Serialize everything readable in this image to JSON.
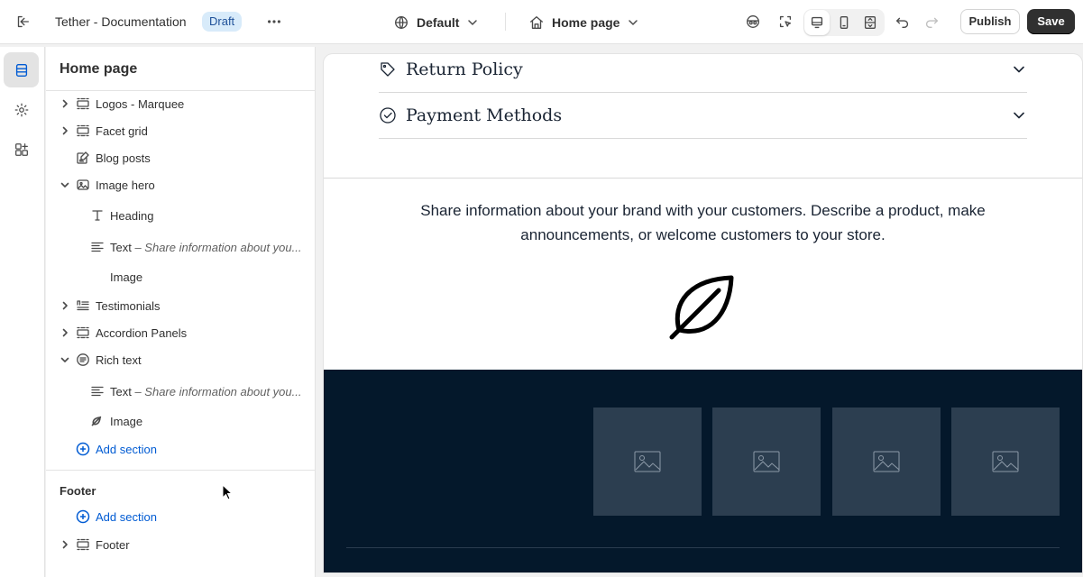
{
  "header": {
    "app_title": "Tether - Documentation",
    "status_badge": "Draft",
    "theme_select": "Default",
    "page_select": "Home page",
    "publish_label": "Publish",
    "save_label": "Save"
  },
  "sidebar": {
    "title": "Home page",
    "items": [
      {
        "label": "Logos - Marquee",
        "icon": "section-icon",
        "expandable": true,
        "expanded": false
      },
      {
        "label": "Facet grid",
        "icon": "section-icon",
        "expandable": true,
        "expanded": false
      },
      {
        "label": "Blog posts",
        "icon": "blog-icon",
        "expandable": false
      },
      {
        "label": "Image hero",
        "icon": "image-section-icon",
        "expandable": true,
        "expanded": true
      },
      {
        "label": "Heading",
        "icon": "text-type-icon",
        "level": 2
      },
      {
        "label": "Text",
        "suffix": " – Share information about you...",
        "icon": "text-lines-icon",
        "level": 2
      },
      {
        "label": "Image",
        "icon": "none",
        "level": 2
      },
      {
        "label": "Testimonials",
        "icon": "testimonials-icon",
        "expandable": true,
        "expanded": false
      },
      {
        "label": "Accordion Panels",
        "icon": "section-icon",
        "expandable": true,
        "expanded": false
      },
      {
        "label": "Rich text",
        "icon": "rich-text-icon",
        "expandable": true,
        "expanded": true
      },
      {
        "label": "Text",
        "suffix": " – Share information about you...",
        "icon": "text-lines-icon",
        "level": 2
      },
      {
        "label": "Image",
        "icon": "leaf-icon",
        "level": 2
      }
    ],
    "add_section_label": "Add section",
    "footer_heading": "Footer",
    "footer_add_section_label": "Add section",
    "footer_item": "Footer"
  },
  "preview": {
    "accordion": [
      {
        "title": "Return Policy",
        "icon": "tag-icon"
      },
      {
        "title": "Payment Methods",
        "icon": "check-circle-icon"
      }
    ],
    "rich_text": "Share information about your brand with your customers. Describe a product, make announcements, or welcome customers to your store.",
    "dark_band_color": "#04182b",
    "placeholder_count": 4
  },
  "colors": {
    "accent": "#005bd3",
    "save_button": "#303030",
    "badge_bg": "#d8ebfa"
  }
}
